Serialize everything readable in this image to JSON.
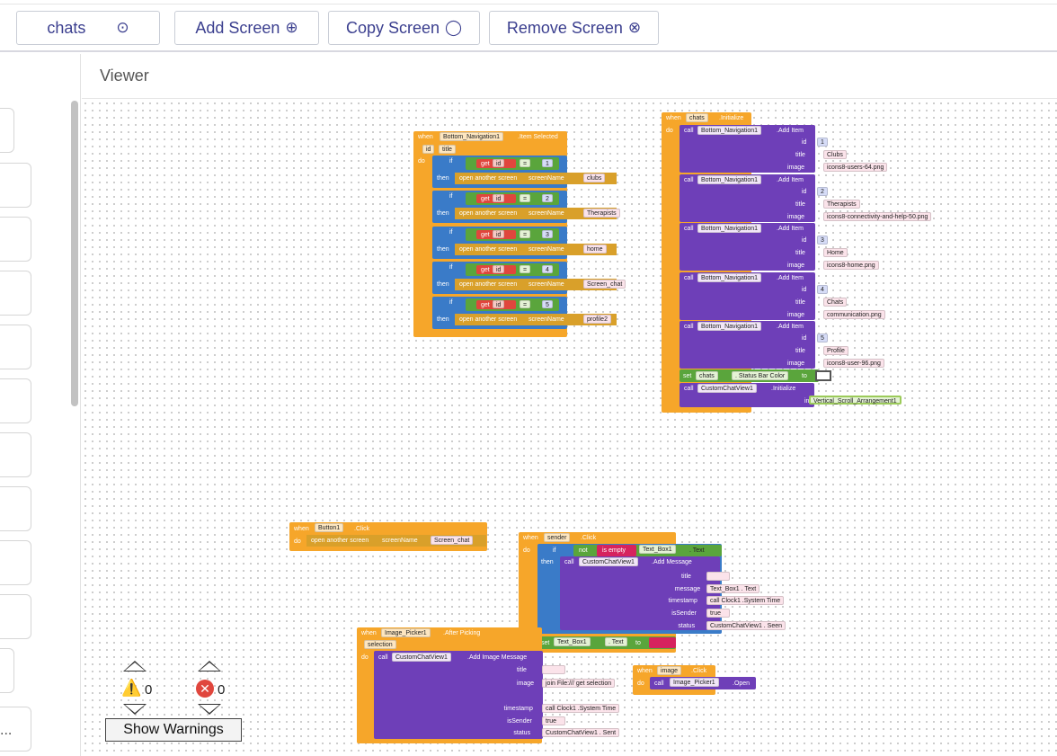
{
  "toolbar": {
    "screen_select": {
      "label": "chats",
      "icon": "chevron-circle-down-icon"
    },
    "add_screen": {
      "label": "Add Screen",
      "icon": "plus-circle-icon"
    },
    "copy_screen": {
      "label": "Copy Screen",
      "icon": "copy-circle-icon"
    },
    "remove_screen": {
      "label": "Remove Screen",
      "icon": "x-circle-icon"
    }
  },
  "viewer": {
    "title": "Viewer"
  },
  "sidebar": {
    "overflow_text": "..."
  },
  "warnings": {
    "warning_count": "0",
    "error_count": "0",
    "show_label": "Show Warnings"
  },
  "blocks": {
    "nav_selected": {
      "header": [
        "when",
        "Bottom_Navigation1",
        ".Item Selected"
      ],
      "params": [
        "id",
        "title"
      ],
      "cases": [
        {
          "n": "1",
          "screen": "clubs"
        },
        {
          "n": "2",
          "screen": "Therapists"
        },
        {
          "n": "3",
          "screen": "home"
        },
        {
          "n": "4",
          "screen": "Screen_chat"
        },
        {
          "n": "5",
          "screen": "profile2"
        }
      ],
      "if_text": "if",
      "then_text": "then",
      "get_text": "get",
      "id_text": "id",
      "eq_text": "=",
      "open_text": "open another screen",
      "screenName_text": "screenName",
      "do_text": "do"
    },
    "chats_init": {
      "header": [
        "when",
        "chats",
        ".Initialize"
      ],
      "items": [
        {
          "id": "1",
          "title": "Clubs",
          "image": "icons8-users-64.png"
        },
        {
          "id": "2",
          "title": "Therapists",
          "image": "icons8-connectivity-and-help-50.png"
        },
        {
          "id": "3",
          "title": "Home",
          "image": "icons8-home.png"
        },
        {
          "id": "4",
          "title": "Chats",
          "image": "communication.png"
        },
        {
          "id": "5",
          "title": "Profile",
          "image": "icons8-user-96.png"
        }
      ],
      "call_text": "call",
      "component": "Bottom_Navigation1",
      "method": ".Add Item",
      "id_label": "id",
      "title_label": "title",
      "image_label": "image",
      "set_line": [
        "set",
        "chats",
        ". Status Bar Color",
        "to"
      ],
      "init_line": [
        "call",
        "CustomChatView1",
        ".Initialize"
      ],
      "in_label": "in",
      "in_value": "Vertical_Scroll_Arrangement1",
      "do_text": "do"
    },
    "button_click": {
      "header": [
        "when",
        "Button1",
        ".Click"
      ],
      "body": [
        "do",
        "open another screen",
        "screenName",
        "Screen_chat"
      ]
    },
    "sender_click": {
      "header": [
        "when",
        "sender",
        ".Click"
      ],
      "if_line": [
        "if",
        "not",
        "is empty",
        "Text_Box1",
        ". Text"
      ],
      "call_line": [
        "then",
        "call",
        "CustomChatView1",
        ".Add Message"
      ],
      "args": [
        {
          "label": "title",
          "value": ""
        },
        {
          "label": "message",
          "value": "Text_Box1 . Text"
        },
        {
          "label": "timestamp",
          "value": "call Clock1 .System Time"
        },
        {
          "label": "isSender",
          "value": "true"
        },
        {
          "label": "status",
          "value": "CustomChatView1 . Seen"
        }
      ],
      "set_line": [
        "set",
        "Text_Box1",
        ". Text",
        "to"
      ],
      "do_text": "do"
    },
    "picker_after": {
      "header": [
        "when",
        "Image_Picker1",
        ".After Picking"
      ],
      "param": "selection",
      "call_line": [
        "call",
        "CustomChatView1",
        ".Add Image Message"
      ],
      "args": [
        {
          "label": "title",
          "value": ""
        },
        {
          "label": "image",
          "value": "join  File:///  get selection"
        },
        {
          "label": "timestamp",
          "value": "call Clock1 .System Time"
        },
        {
          "label": "isSender",
          "value": "true"
        },
        {
          "label": "status",
          "value": "CustomChatView1 . Sent"
        }
      ],
      "do_text": "do"
    },
    "image_click": {
      "header": [
        "when",
        "image",
        ".Click"
      ],
      "body": [
        "do",
        "call",
        "Image_Picker1",
        ".Open"
      ]
    }
  },
  "colors": {
    "event": "#f6a62a",
    "component": "#6e3fb8",
    "logic": "#5aa53c",
    "text": "#d6235e",
    "math": "#2f8fcf",
    "accent": "#3b3f8f"
  }
}
